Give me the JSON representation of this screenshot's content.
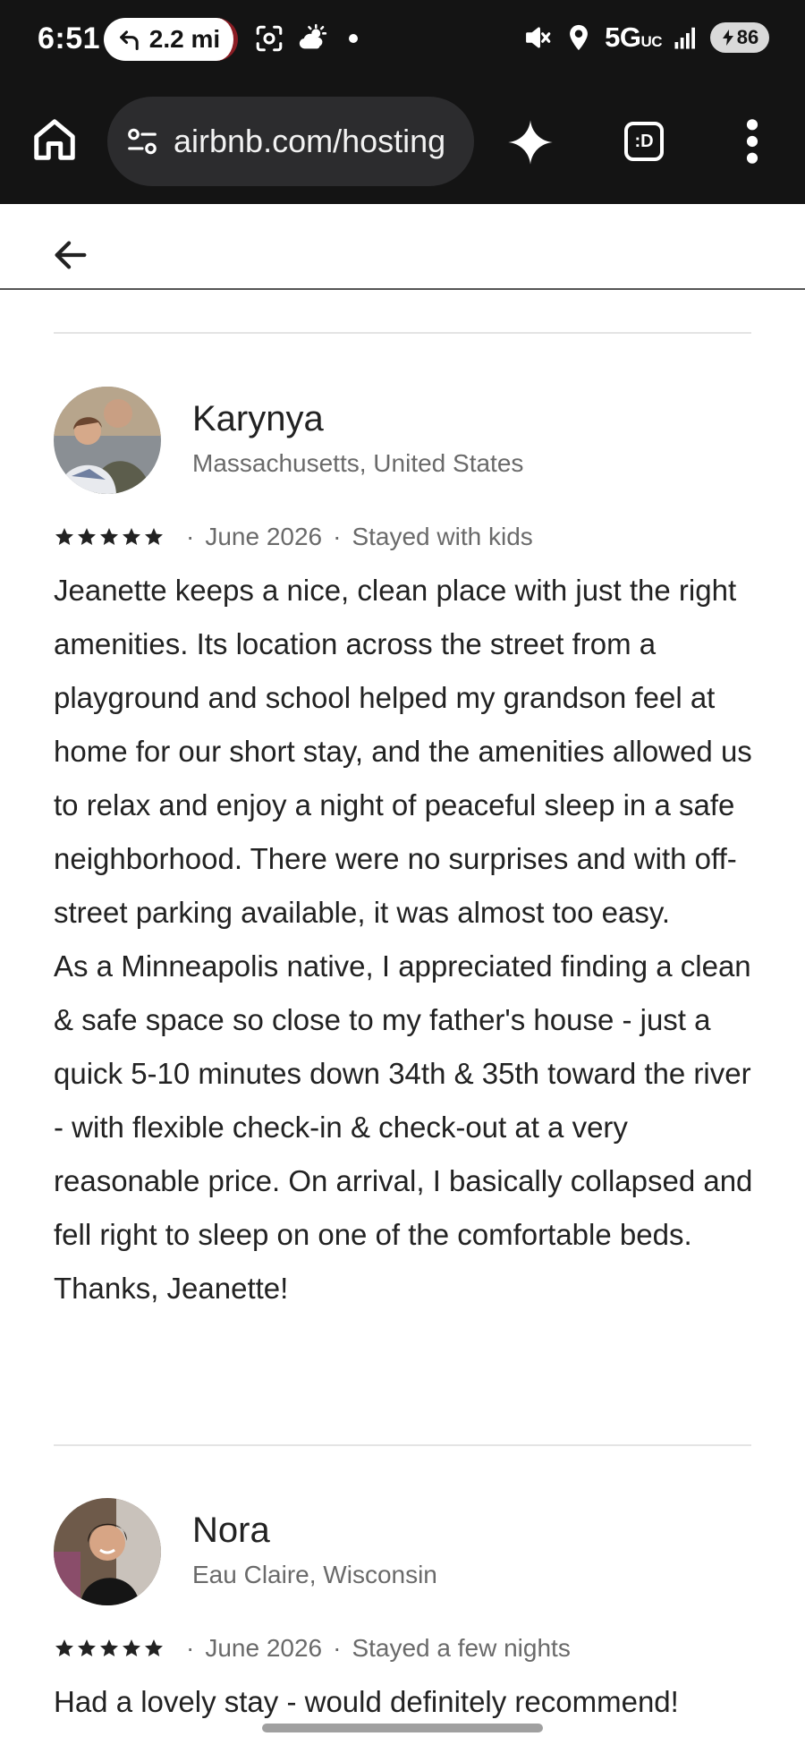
{
  "status_bar": {
    "time": "6:51",
    "navigation_distance": "2.2 mi",
    "network": "5G",
    "network_suffix": "UC",
    "battery": "86"
  },
  "browser": {
    "url": "airbnb.com/hosting",
    "tab_label": ":D"
  },
  "reviews": [
    {
      "name": "Karynya",
      "location": "Massachusetts, United States",
      "rating": 5,
      "date": "June 2026",
      "stay_type": "Stayed with kids",
      "text": "Jeanette keeps a nice, clean place with just the right amenities. Its location across the street from a playground and school helped my grandson feel at home for our short stay, and the amenities allowed us to relax and enjoy a night of peaceful sleep in a safe neighborhood. There were no surprises and with off-street parking available, it was almost too easy.\nAs a Minneapolis native, I appreciated finding a clean & safe space so close to my father's house - just a quick 5-10 minutes down 34th & 35th toward the river - with flexible check-in & check-out at a very reasonable price. On arrival, I basically collapsed and fell right to sleep on one of the comfortable beds. Thanks, Jeanette!"
    },
    {
      "name": "Nora",
      "location": "Eau Claire, Wisconsin",
      "rating": 5,
      "date": "June 2026",
      "stay_type": "Stayed a few nights",
      "text": "Had a lovely stay - would definitely recommend!"
    }
  ],
  "separator": "·",
  "colors": {
    "system_bar": "#141414",
    "url_bar": "#2c2c2e",
    "text_primary": "#222222",
    "text_secondary": "#6a6a6a",
    "divider": "#e4e4e4"
  }
}
